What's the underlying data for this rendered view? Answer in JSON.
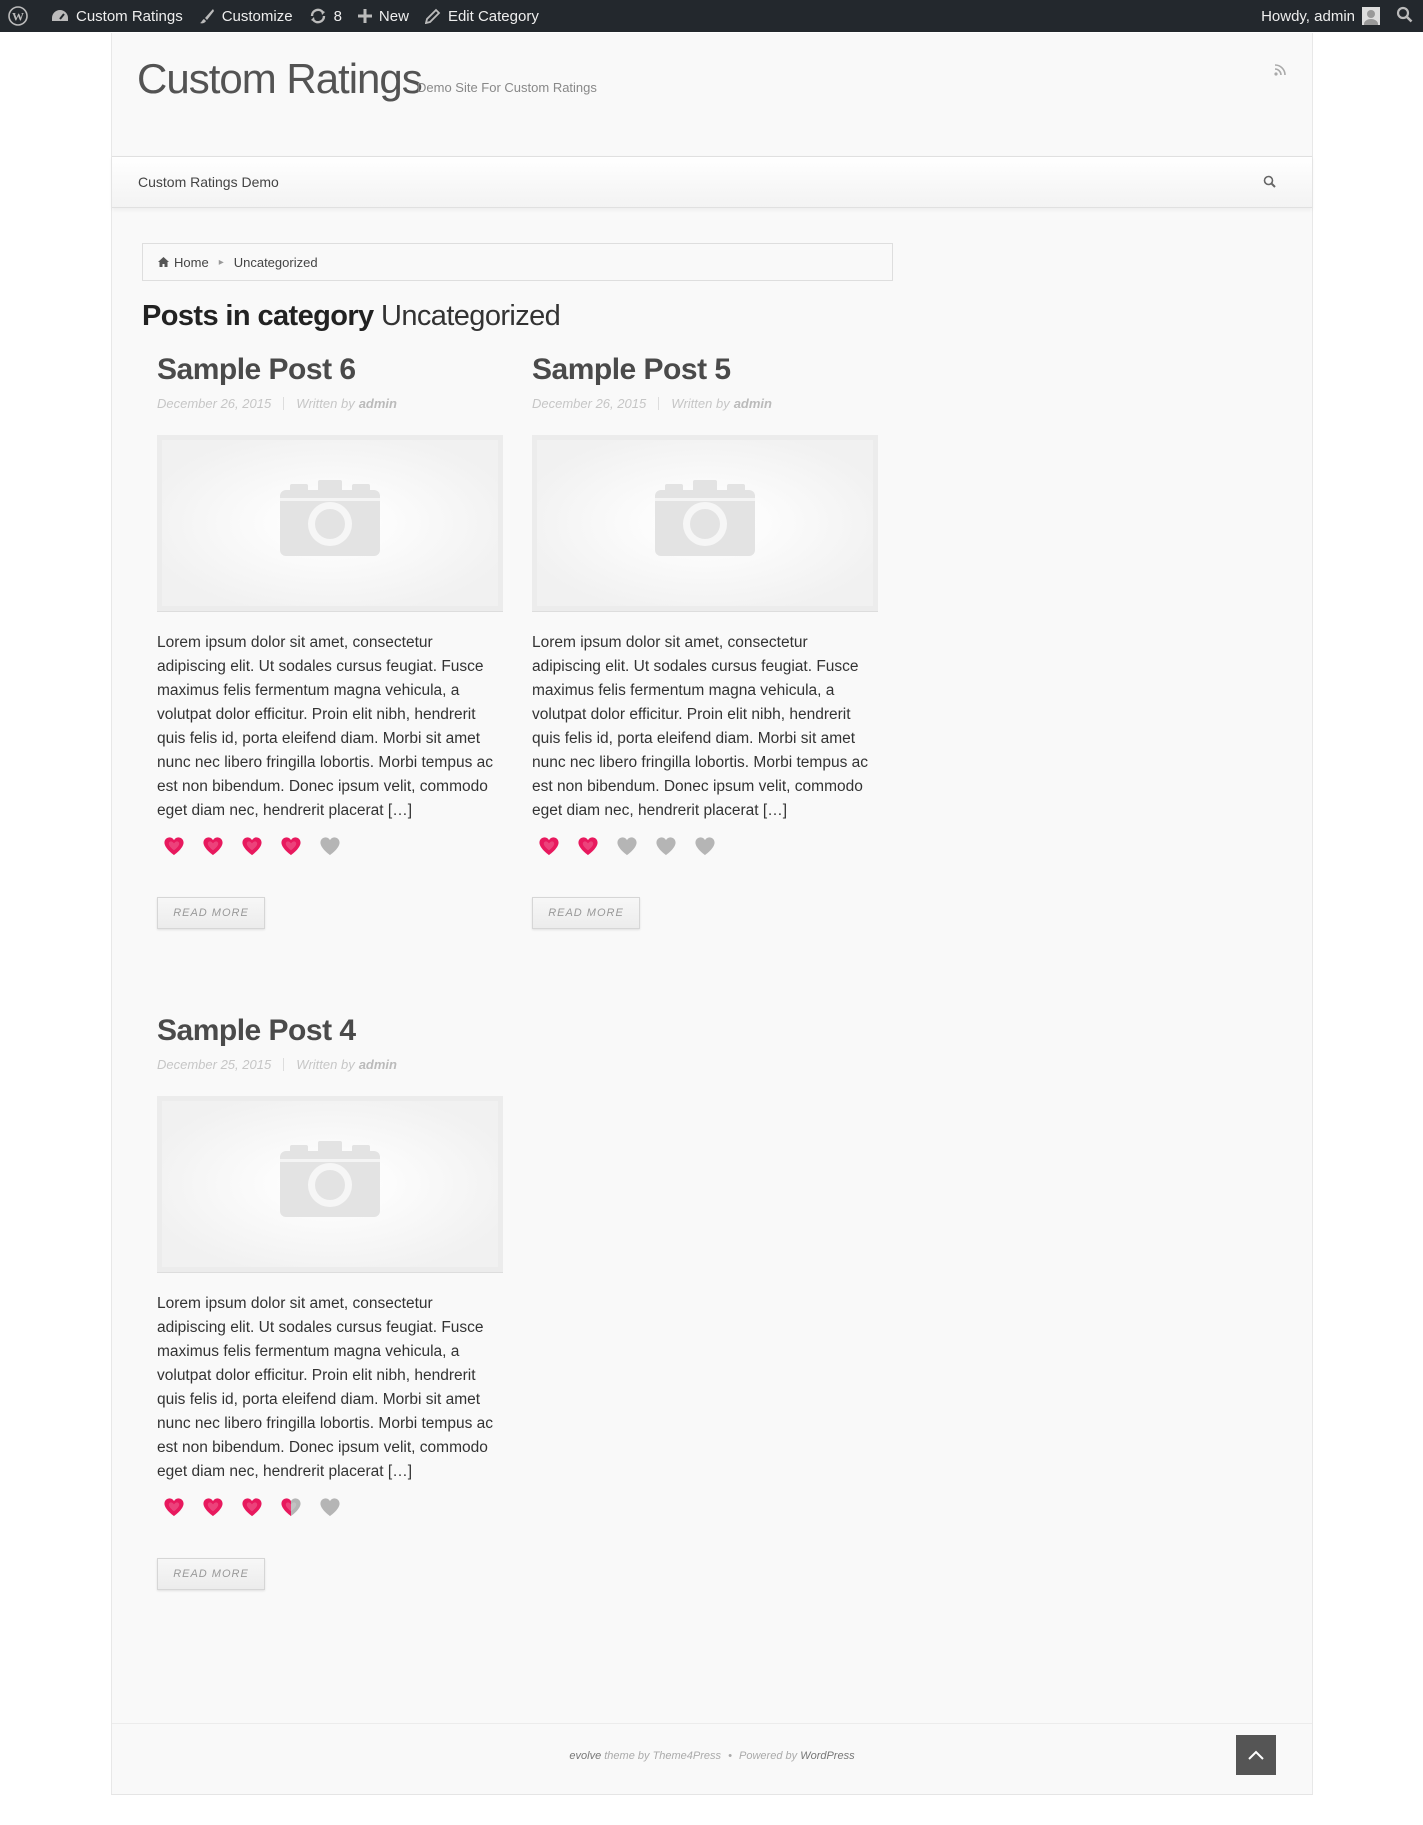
{
  "adminbar": {
    "site_name": "Custom Ratings",
    "customize": "Customize",
    "updates_count": "8",
    "new": "New",
    "edit_category": "Edit Category",
    "howdy": "Howdy, admin"
  },
  "header": {
    "site_title": "Custom Ratings",
    "tagline": "Demo Site For Custom Ratings"
  },
  "nav": {
    "items": [
      {
        "label": "Custom Ratings Demo"
      }
    ]
  },
  "breadcrumb": {
    "home": "Home",
    "current": "Uncategorized"
  },
  "archive": {
    "prefix": "Posts in category",
    "category": "Uncategorized"
  },
  "posts": [
    {
      "title": "Sample Post 6",
      "date": "December 26, 2015",
      "written_by": "Written by",
      "author": "admin",
      "excerpt": "Lorem ipsum dolor sit amet, consectetur adipiscing elit. Ut sodales cursus feugiat. Fusce maximus felis fermentum magna vehicula, a volutpat dolor efficitur. Proin elit nibh, hendrerit quis felis id, porta eleifend diam. Morbi sit amet nunc nec libero fringilla lobortis. Morbi tempus ac est non bibendum. Donec ipsum velit, commodo eget diam nec, hendrerit placerat […]",
      "rating": 4,
      "rating_max": 5,
      "read_more": "READ MORE"
    },
    {
      "title": "Sample Post 5",
      "date": "December 26, 2015",
      "written_by": "Written by",
      "author": "admin",
      "excerpt": "Lorem ipsum dolor sit amet, consectetur adipiscing elit. Ut sodales cursus feugiat. Fusce maximus felis fermentum magna vehicula, a volutpat dolor efficitur. Proin elit nibh, hendrerit quis felis id, porta eleifend diam. Morbi sit amet nunc nec libero fringilla lobortis. Morbi tempus ac est non bibendum. Donec ipsum velit, commodo eget diam nec, hendrerit placerat […]",
      "rating": 2,
      "rating_max": 5,
      "read_more": "READ MORE"
    },
    {
      "title": "Sample Post 4",
      "date": "December 25, 2015",
      "written_by": "Written by",
      "author": "admin",
      "excerpt": "Lorem ipsum dolor sit amet, consectetur adipiscing elit. Ut sodales cursus feugiat. Fusce maximus felis fermentum magna vehicula, a volutpat dolor efficitur. Proin elit nibh, hendrerit quis felis id, porta eleifend diam. Morbi sit amet nunc nec libero fringilla lobortis. Morbi tempus ac est non bibendum. Donec ipsum velit, commodo eget diam nec, hendrerit placerat […]",
      "rating": 3.5,
      "rating_max": 5,
      "read_more": "READ MORE"
    }
  ],
  "footer": {
    "theme": "evolve",
    "theme_by": "theme by",
    "theme_author": "Theme4Press",
    "dot": "•",
    "powered_by": "Powered by",
    "wordpress": "WordPress"
  },
  "colors": {
    "heart_filled": "#e8195e",
    "heart_empty": "#b5b5b5"
  },
  "icons": [
    "wordpress-icon",
    "dashboard-icon",
    "brush-icon",
    "update-icon",
    "plus-icon",
    "pencil-icon",
    "avatar",
    "search-icon",
    "rss-icon",
    "home-icon",
    "camera-icon",
    "heart-icon",
    "arrow-up-icon"
  ]
}
